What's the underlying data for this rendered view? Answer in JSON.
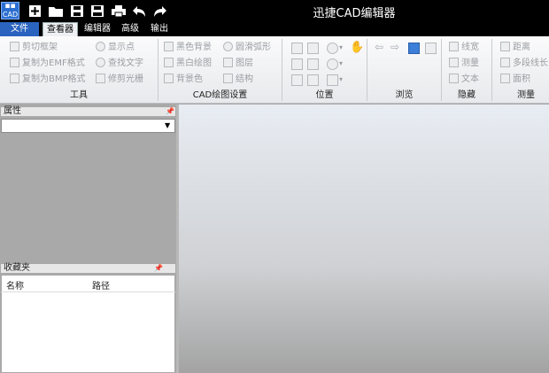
{
  "window": {
    "title": "迅捷CAD编辑器",
    "logo_text": "CAD"
  },
  "quick_access": [
    "new-icon",
    "open-icon",
    "save-icon",
    "save-as-icon",
    "print-icon",
    "undo-icon",
    "redo-icon"
  ],
  "menu_tabs": [
    "文件",
    "查看器",
    "编辑器",
    "高级",
    "输出"
  ],
  "ribbon": {
    "tools": {
      "title": "工具",
      "items": [
        "剪切框架",
        "复制为EMF格式",
        "复制为BMP格式",
        "显示点",
        "查找文字",
        "修剪光栅"
      ]
    },
    "cad_settings": {
      "title": "CAD绘图设置",
      "items": [
        "黑色背景",
        "黑白绘图",
        "背景色",
        "圆滑弧形",
        "图层",
        "结构"
      ]
    },
    "position": {
      "title": "位置"
    },
    "browse": {
      "title": "浏览"
    },
    "hide": {
      "title": "隐藏",
      "items": [
        "线宽",
        "测量",
        "文本"
      ]
    },
    "measure": {
      "title": "测量",
      "items": [
        "距离",
        "多段线长",
        "面积"
      ]
    }
  },
  "properties_panel": {
    "title": "属性"
  },
  "favorites_panel": {
    "title": "收藏夹",
    "columns": [
      "名称",
      "路径"
    ]
  }
}
